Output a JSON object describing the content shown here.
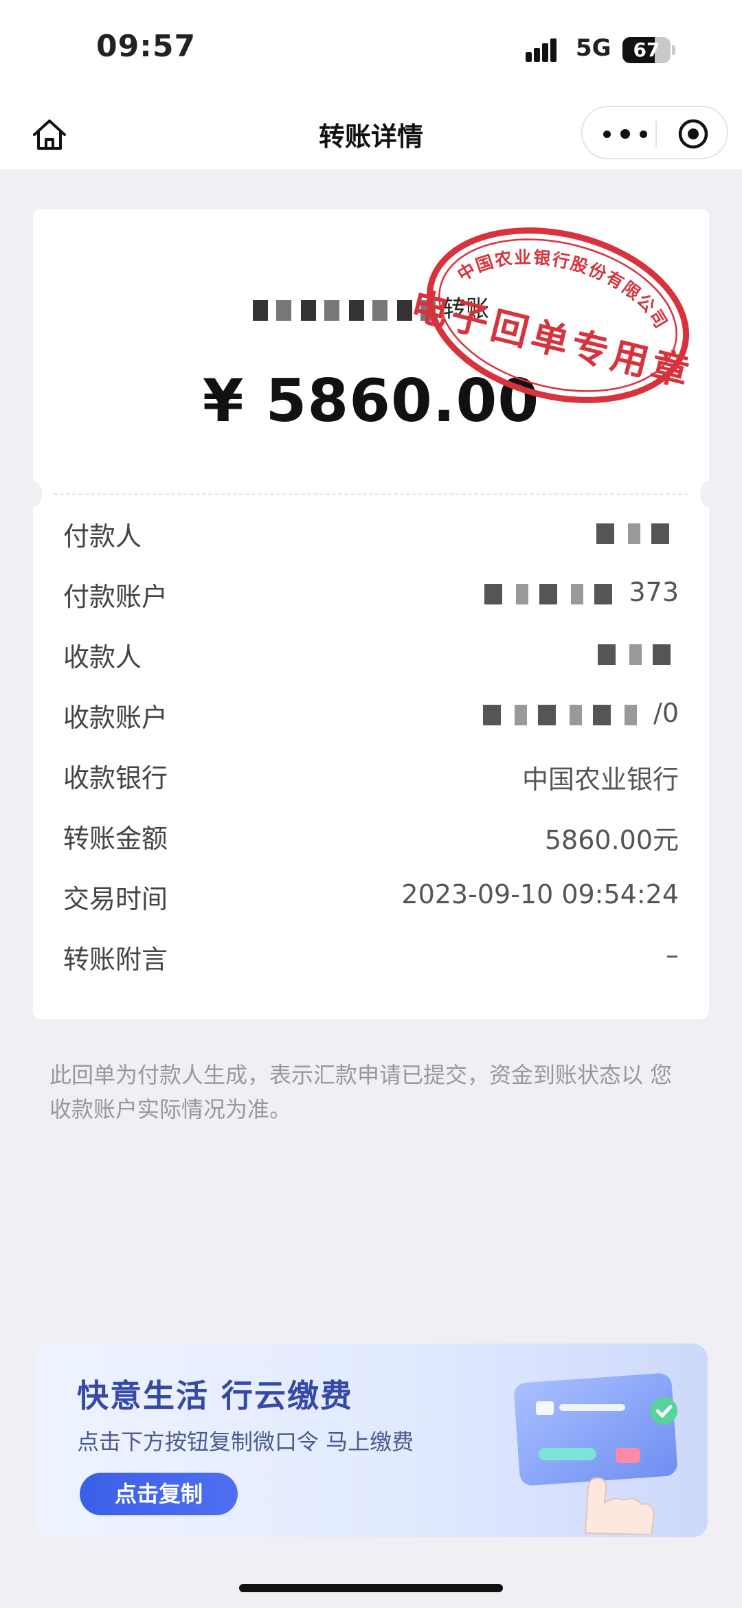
{
  "status_bar": {
    "time": "09:57",
    "network": "5G",
    "battery": "67",
    "battery_level": 0.67
  },
  "nav": {
    "title": "转账详情",
    "home_icon": "home-icon",
    "more_icon": "more-dots-icon",
    "close_icon": "target-circle-icon"
  },
  "receipt": {
    "type_suffix": "转账",
    "amount": "¥ 5860.00",
    "stamp": {
      "bank_line": "中国农业银行股份有限公司",
      "title": "电子回单专用章",
      "color": "#d8323c"
    },
    "rows": [
      {
        "label": "付款人",
        "value": ""
      },
      {
        "label": "付款账户",
        "value": "373"
      },
      {
        "label": "收款人",
        "value": ""
      },
      {
        "label": "收款账户",
        "value": "/0"
      },
      {
        "label": "收款银行",
        "value": "中国农业银行"
      },
      {
        "label": "转账金额",
        "value": "5860.00元"
      },
      {
        "label": "交易时间",
        "value": "2023-09-10 09:54:24"
      },
      {
        "label": "转账附言",
        "value": "–"
      }
    ]
  },
  "note": "此回单为付款人生成，表示汇款申请已提交，资金到账状态以 您收款账户实际情况为准。",
  "banner": {
    "title": "快意生活 行云缴费",
    "subtitle": "点击下方按钮复制微口令 马上缴费",
    "button": "点击复制",
    "accent": "#3a5fe8"
  }
}
